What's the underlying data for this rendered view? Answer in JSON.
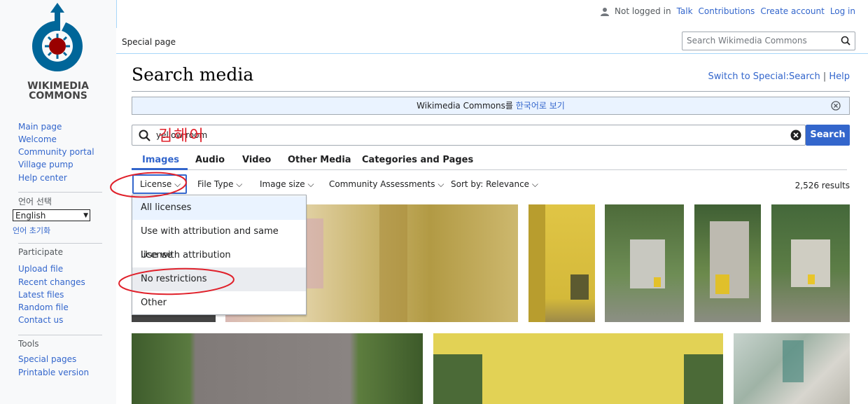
{
  "personal": {
    "status": "Not logged in",
    "talk": "Talk",
    "contributions": "Contributions",
    "create": "Create account",
    "login": "Log in"
  },
  "logo": {
    "line1": "WIKIMEDIA",
    "line2": "COMMONS"
  },
  "sidebar": {
    "nav": [
      "Main page",
      "Welcome",
      "Community portal",
      "Village pump",
      "Help center"
    ],
    "lang_heading": "언어 선택",
    "lang_value": "English",
    "lang_reset": "언어 초기화",
    "participate_heading": "Participate",
    "participate": [
      "Upload file",
      "Recent changes",
      "Latest files",
      "Random file",
      "Contact us"
    ],
    "tools_heading": "Tools",
    "tools": [
      "Special pages",
      "Printable version"
    ]
  },
  "tab_special": "Special page",
  "header_search_placeholder": "Search Wikimedia Commons",
  "title": "Search media",
  "toplinks": {
    "switch": "Switch to Special:Search",
    "sep": "|",
    "help": "Help"
  },
  "notice": {
    "prefix": "Wikimedia Commons를 ",
    "link": "한국어로 보기"
  },
  "search": {
    "query": "yellow room",
    "button": "Search"
  },
  "media_tabs": [
    "Images",
    "Audio",
    "Video",
    "Other Media",
    "Categories and Pages"
  ],
  "filters": [
    "License",
    "File Type",
    "Image size",
    "Community Assessments",
    "Sort by: Relevance"
  ],
  "results": "2,526 results",
  "license_options": [
    "All licenses",
    "Use with attribution and same license",
    "Use with attribution",
    "No restrictions",
    "Other"
  ],
  "annotation_handwriting": "김해어",
  "colors": {
    "link": "#3366cc",
    "accent": "#3366cc",
    "annotation": "#e0202a"
  }
}
